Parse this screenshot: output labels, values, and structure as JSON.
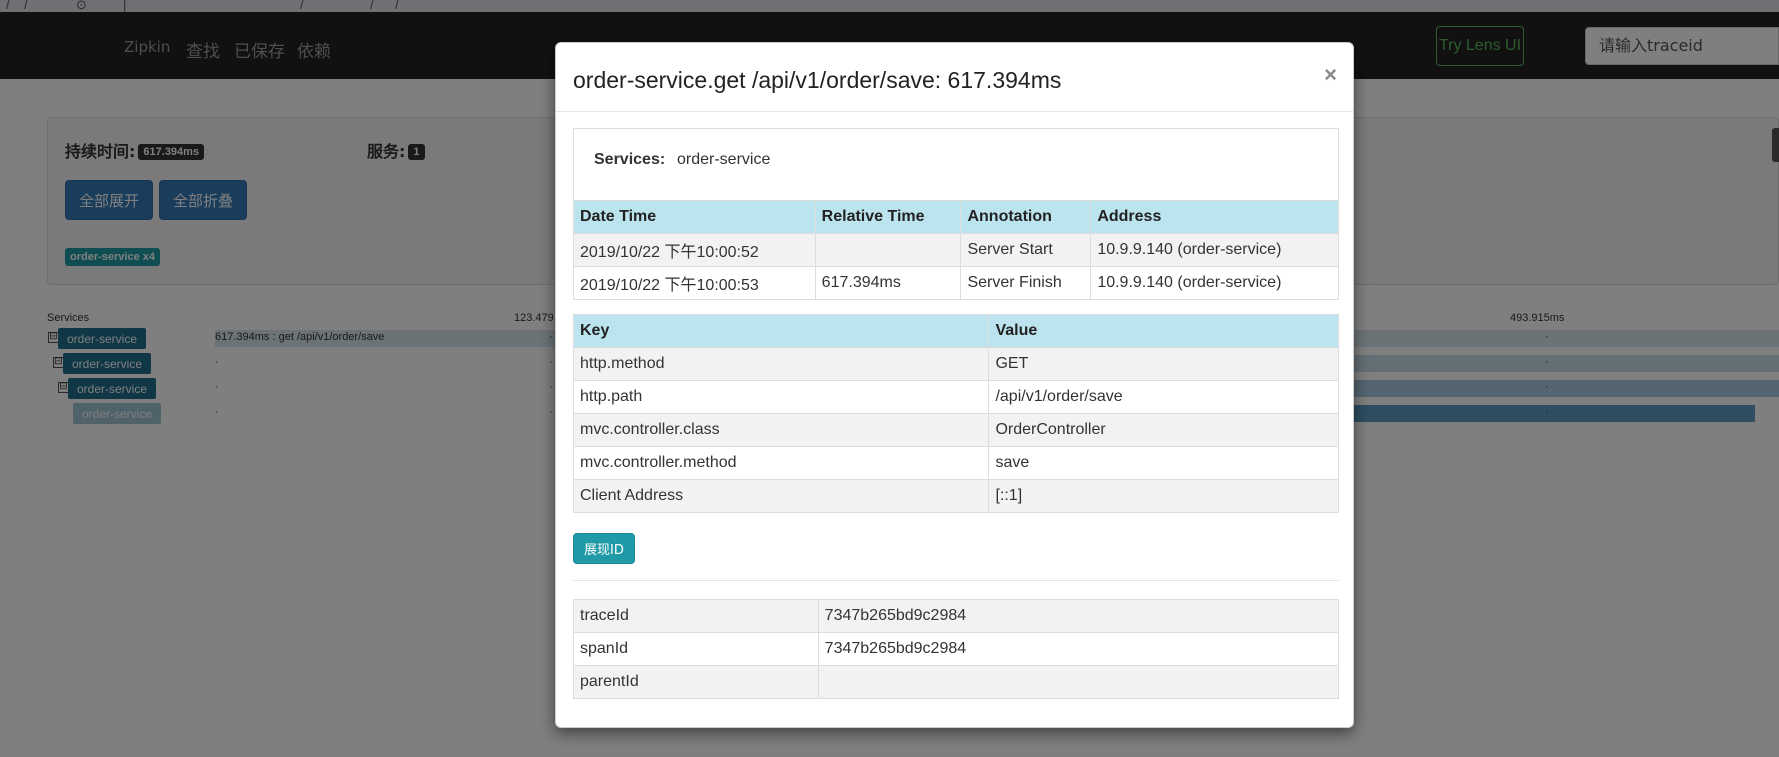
{
  "browser": {
    "glyphs": [
      "/",
      "/",
      "⊙",
      "|",
      "/",
      "/",
      "/"
    ]
  },
  "navbar": {
    "brand": "Zipkin",
    "links": [
      "查找",
      "已保存",
      "依赖"
    ],
    "lens_button": "Try Lens UI",
    "search_placeholder": "请输入traceid"
  },
  "summary": {
    "duration_label": "持续时间:",
    "duration_value": "617.394ms",
    "services_label": "服务:",
    "services_count": "1",
    "expand_all": "全部展开",
    "collapse_all": "全部折叠",
    "service_tag": "order-service x4"
  },
  "timeline": {
    "services_header": "Services",
    "tick_1": "123.479",
    "tick_2": "493.915ms",
    "toggle_glyph": "⊟",
    "rows": [
      {
        "service": "order-service",
        "label": "617.394ms : get /api/v1/order/save"
      },
      {
        "service": "order-service",
        "label": ""
      },
      {
        "service": "order-service",
        "label": ""
      },
      {
        "service": "order-service",
        "label": ""
      }
    ],
    "dot": "·"
  },
  "modal": {
    "title": "order-service.get /api/v1/order/save: 617.394ms",
    "close": "×",
    "services_label": "Services:",
    "services_value": "order-service",
    "annotations": {
      "headers": [
        "Date Time",
        "Relative Time",
        "Annotation",
        "Address"
      ],
      "rows": [
        [
          "2019/10/22 下午10:00:52",
          "",
          "Server Start",
          "10.9.9.140 (order-service)"
        ],
        [
          "2019/10/22 下午10:00:53",
          "617.394ms",
          "Server Finish",
          "10.9.9.140 (order-service)"
        ]
      ]
    },
    "tags": {
      "headers": [
        "Key",
        "Value"
      ],
      "rows": [
        [
          "http.method",
          "GET"
        ],
        [
          "http.path",
          "/api/v1/order/save"
        ],
        [
          "mvc.controller.class",
          "OrderController"
        ],
        [
          "mvc.controller.method",
          "save"
        ],
        [
          "Client Address",
          "[::1]"
        ]
      ]
    },
    "show_ids_button": "展现ID",
    "ids": {
      "rows": [
        [
          "traceId",
          "7347b265bd9c2984"
        ],
        [
          "spanId",
          "7347b265bd9c2984"
        ],
        [
          "parentId",
          ""
        ]
      ]
    }
  }
}
